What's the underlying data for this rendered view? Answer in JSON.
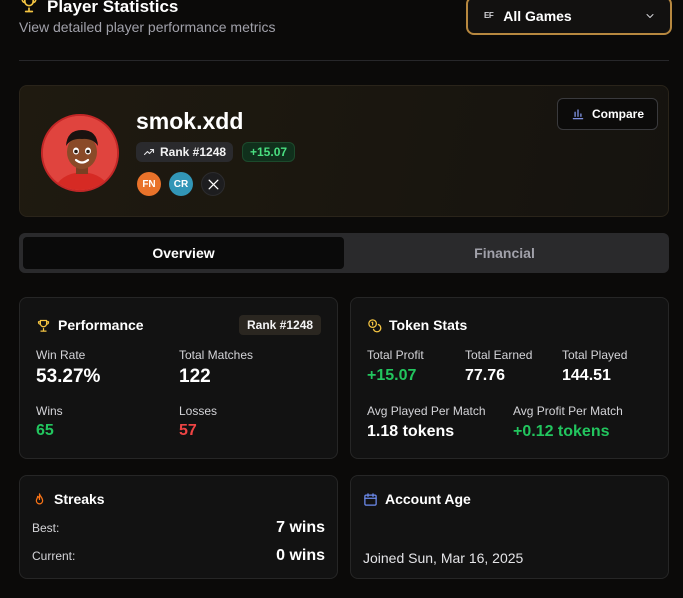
{
  "header": {
    "title": "Player Statistics",
    "subtitle": "View detailed player performance metrics",
    "game_select": {
      "icon_text": "EF",
      "value": "All Games"
    }
  },
  "profile": {
    "username": "smok.xdd",
    "rank": "Rank #1248",
    "delta": "+15.07",
    "platforms": [
      "FN",
      "CR",
      "X"
    ],
    "compare_label": "Compare"
  },
  "tabs": [
    {
      "label": "Overview",
      "active": true
    },
    {
      "label": "Financial",
      "active": false
    }
  ],
  "performance": {
    "title": "Performance",
    "rank_badge": "Rank #1248",
    "win_rate_label": "Win Rate",
    "win_rate": "53.27%",
    "total_matches_label": "Total Matches",
    "total_matches": "122",
    "wins_label": "Wins",
    "wins": "65",
    "losses_label": "Losses",
    "losses": "57"
  },
  "token_stats": {
    "title": "Token Stats",
    "total_profit_label": "Total Profit",
    "total_profit": "+15.07",
    "total_earned_label": "Total Earned",
    "total_earned": "77.76",
    "total_played_label": "Total Played",
    "total_played": "144.51",
    "avg_played_label": "Avg Played Per Match",
    "avg_played": "1.18 tokens",
    "avg_profit_label": "Avg Profit Per Match",
    "avg_profit": "+0.12 tokens"
  },
  "streaks": {
    "title": "Streaks",
    "best_label": "Best:",
    "best": "7 wins",
    "current_label": "Current:",
    "current": "0 wins"
  },
  "account_age": {
    "title": "Account Age",
    "joined": "Joined Sun, Mar 16, 2025"
  },
  "colors": {
    "accent_gold": "#b7883f",
    "positive": "#22c55e",
    "negative": "#ef4444",
    "calendar_blue": "#6d8cf0"
  }
}
